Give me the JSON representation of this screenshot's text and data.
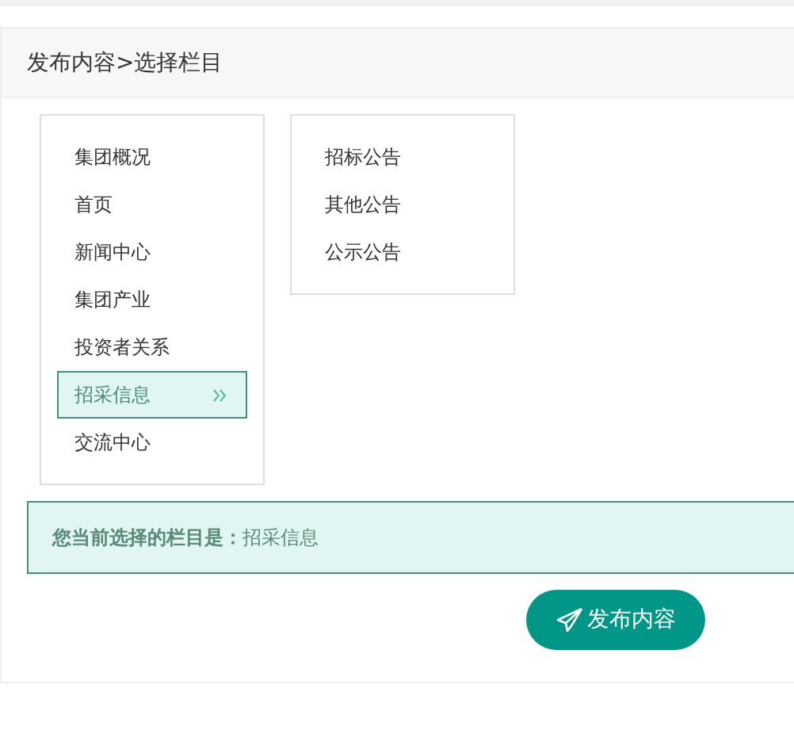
{
  "header": {
    "title": "发布内容>选择栏目"
  },
  "categories": [
    {
      "label": "集团概况",
      "selected": false
    },
    {
      "label": "首页",
      "selected": false
    },
    {
      "label": "新闻中心",
      "selected": false
    },
    {
      "label": "集团产业",
      "selected": false
    },
    {
      "label": "投资者关系",
      "selected": false
    },
    {
      "label": "招采信息",
      "selected": true
    },
    {
      "label": "交流中心",
      "selected": false
    }
  ],
  "subcategories": [
    {
      "label": "招标公告",
      "selected": false
    },
    {
      "label": "其他公告",
      "selected": false
    },
    {
      "label": "公示公告",
      "selected": false
    }
  ],
  "selection_notice": {
    "label": "您当前选择的栏目是：",
    "value": "招采信息"
  },
  "publish_button": {
    "label": "发布内容"
  }
}
